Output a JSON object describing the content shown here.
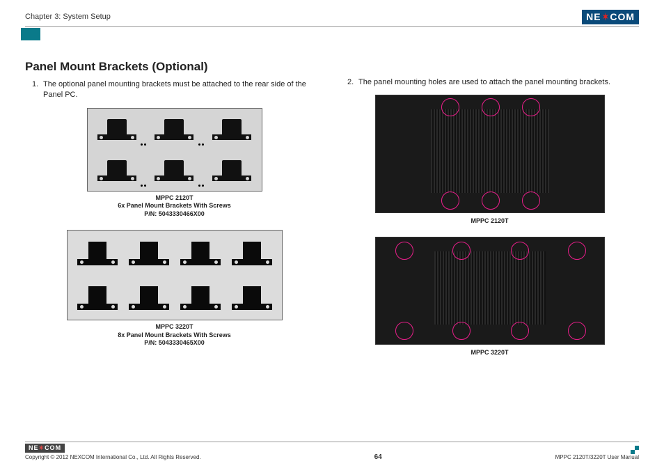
{
  "header": {
    "chapter": "Chapter 3: System Setup",
    "logo_text_1": "NE",
    "logo_text_2": "COM"
  },
  "section": {
    "title": "Panel Mount Brackets (Optional)"
  },
  "left": {
    "item1_num": "1.",
    "item1_text": "The optional panel mounting brackets must be attached to the rear side of the Panel PC.",
    "caption1_line1": "MPPC 2120T",
    "caption1_line2": "6x Panel Mount Brackets With Screws",
    "caption1_line3": "P/N: 5043330466X00",
    "caption2_line1": "MPPC 3220T",
    "caption2_line2": "8x Panel Mount Brackets With Screws",
    "caption2_line3": "P/N: 5043330465X00"
  },
  "right": {
    "item2_num": "2.",
    "item2_text": "The panel mounting holes are used to attach the panel mounting brackets.",
    "caption_2120": "MPPC 2120T",
    "caption_3220": "MPPC 3220T"
  },
  "footer": {
    "logo_1": "NE",
    "logo_2": "COM",
    "copyright": "Copyright © 2012 NEXCOM International Co., Ltd. All Rights Reserved.",
    "page_num": "64",
    "manual": "MPPC 2120T/3220T User Manual"
  }
}
